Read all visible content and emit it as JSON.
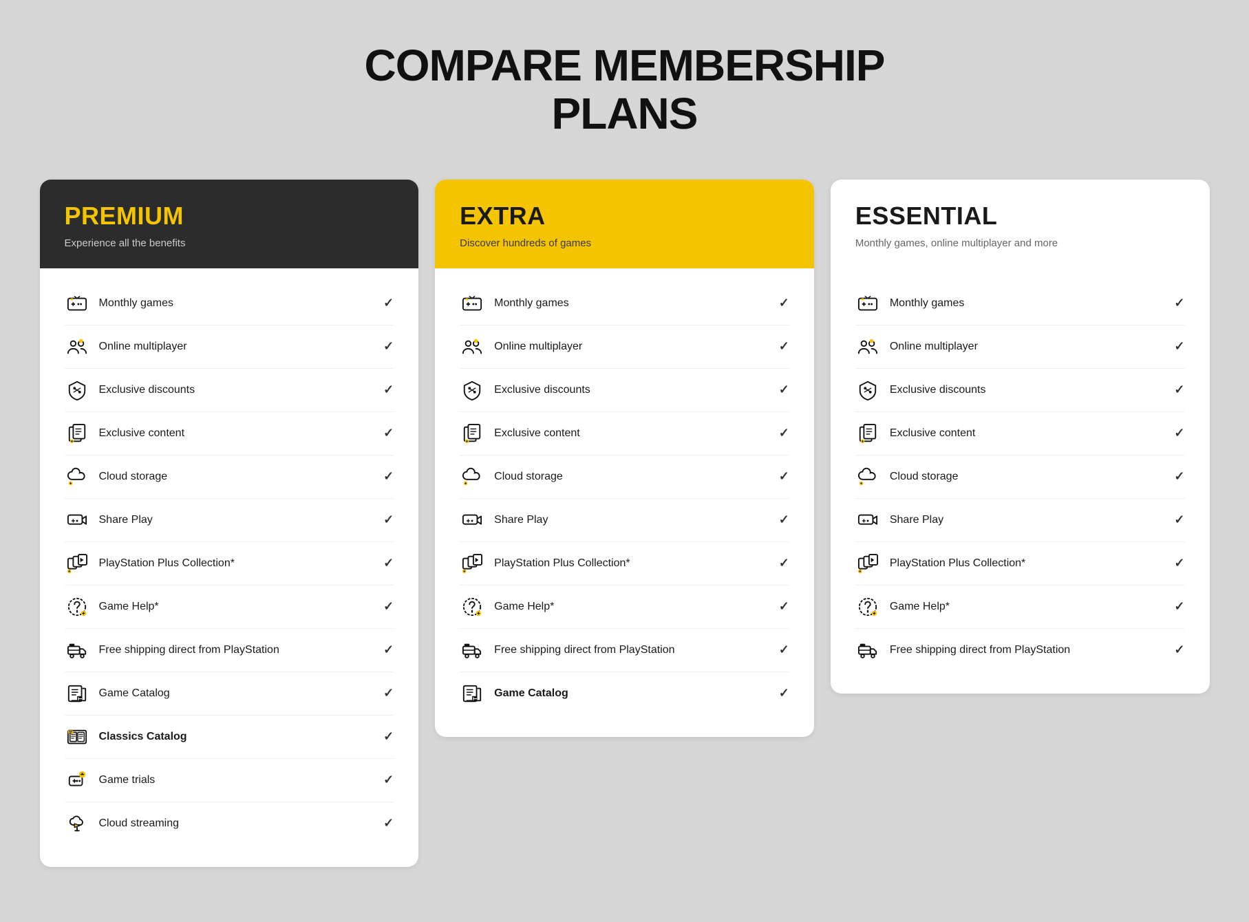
{
  "page": {
    "title_line1": "COMPARE MEMBERSHIP",
    "title_line2": "PLANS"
  },
  "plans": [
    {
      "id": "premium",
      "name": "PREMIUM",
      "subtitle": "Experience all the benefits",
      "headerClass": "premium",
      "features": [
        {
          "label": "Monthly games",
          "icon": "monthly-games",
          "bold": false,
          "checked": true
        },
        {
          "label": "Online multiplayer",
          "icon": "online-multiplayer",
          "bold": false,
          "checked": true
        },
        {
          "label": "Exclusive discounts",
          "icon": "exclusive-discounts",
          "bold": false,
          "checked": true
        },
        {
          "label": "Exclusive content",
          "icon": "exclusive-content",
          "bold": false,
          "checked": true
        },
        {
          "label": "Cloud storage",
          "icon": "cloud-storage",
          "bold": false,
          "checked": true
        },
        {
          "label": "Share Play",
          "icon": "share-play",
          "bold": false,
          "checked": true
        },
        {
          "label": "PlayStation Plus Collection*",
          "icon": "ps-collection",
          "bold": false,
          "checked": true
        },
        {
          "label": "Game Help*",
          "icon": "game-help",
          "bold": false,
          "checked": true
        },
        {
          "label": "Free shipping direct from PlayStation",
          "icon": "free-shipping",
          "bold": false,
          "checked": true
        },
        {
          "label": "Game Catalog",
          "icon": "game-catalog",
          "bold": false,
          "checked": true
        },
        {
          "label": "Classics Catalog",
          "icon": "classics-catalog",
          "bold": true,
          "checked": true
        },
        {
          "label": "Game trials",
          "icon": "game-trials",
          "bold": false,
          "checked": true
        },
        {
          "label": "Cloud streaming",
          "icon": "cloud-streaming",
          "bold": false,
          "checked": true
        }
      ]
    },
    {
      "id": "extra",
      "name": "EXTRA",
      "subtitle": "Discover hundreds of games",
      "headerClass": "extra",
      "features": [
        {
          "label": "Monthly games",
          "icon": "monthly-games",
          "bold": false,
          "checked": true
        },
        {
          "label": "Online multiplayer",
          "icon": "online-multiplayer",
          "bold": false,
          "checked": true
        },
        {
          "label": "Exclusive discounts",
          "icon": "exclusive-discounts",
          "bold": false,
          "checked": true
        },
        {
          "label": "Exclusive content",
          "icon": "exclusive-content",
          "bold": false,
          "checked": true
        },
        {
          "label": "Cloud storage",
          "icon": "cloud-storage",
          "bold": false,
          "checked": true
        },
        {
          "label": "Share Play",
          "icon": "share-play",
          "bold": false,
          "checked": true
        },
        {
          "label": "PlayStation Plus Collection*",
          "icon": "ps-collection",
          "bold": false,
          "checked": true
        },
        {
          "label": "Game Help*",
          "icon": "game-help",
          "bold": false,
          "checked": true
        },
        {
          "label": "Free shipping direct from PlayStation",
          "icon": "free-shipping",
          "bold": false,
          "checked": true
        },
        {
          "label": "Game Catalog",
          "icon": "game-catalog",
          "bold": true,
          "checked": true
        }
      ]
    },
    {
      "id": "essential",
      "name": "ESSENTIAL",
      "subtitle": "Monthly games, online multiplayer and more",
      "headerClass": "essential",
      "features": [
        {
          "label": "Monthly games",
          "icon": "monthly-games",
          "bold": false,
          "checked": true
        },
        {
          "label": "Online multiplayer",
          "icon": "online-multiplayer",
          "bold": false,
          "checked": true
        },
        {
          "label": "Exclusive discounts",
          "icon": "exclusive-discounts",
          "bold": false,
          "checked": true
        },
        {
          "label": "Exclusive content",
          "icon": "exclusive-content",
          "bold": false,
          "checked": true
        },
        {
          "label": "Cloud storage",
          "icon": "cloud-storage",
          "bold": false,
          "checked": true
        },
        {
          "label": "Share Play",
          "icon": "share-play",
          "bold": false,
          "checked": true
        },
        {
          "label": "PlayStation Plus Collection*",
          "icon": "ps-collection",
          "bold": false,
          "checked": true
        },
        {
          "label": "Game Help*",
          "icon": "game-help",
          "bold": false,
          "checked": true
        },
        {
          "label": "Free shipping direct from PlayStation",
          "icon": "free-shipping",
          "bold": false,
          "checked": true
        }
      ]
    }
  ],
  "icons": {
    "monthly-games": "🎮",
    "online-multiplayer": "👥",
    "exclusive-discounts": "🏷️",
    "exclusive-content": "⭐",
    "cloud-storage": "☁️",
    "share-play": "🎮",
    "ps-collection": "🗂️",
    "game-help": "💡",
    "free-shipping": "🚚",
    "game-catalog": "📋",
    "classics-catalog": "🗃️",
    "game-trials": "🎯",
    "cloud-streaming": "📡"
  }
}
